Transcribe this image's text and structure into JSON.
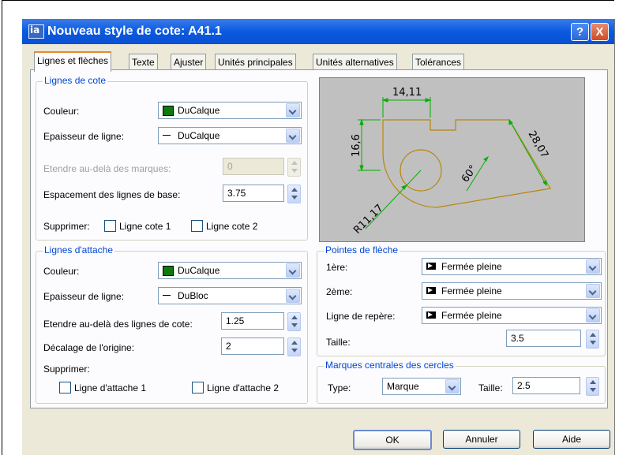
{
  "dialog": {
    "title": "Nouveau style de cote: A41.1",
    "title_icon": "ia",
    "help_label": "?",
    "close_label": "X"
  },
  "tabs": [
    {
      "label": "Lignes et flèches",
      "active": true
    },
    {
      "label": "Texte"
    },
    {
      "label": "Ajuster"
    },
    {
      "label": "Unités principales"
    },
    {
      "label": "Unités alternatives"
    },
    {
      "label": "Tolérances"
    }
  ],
  "lignes_cote": {
    "title": "Lignes de cote",
    "couleur_label": "Couleur:",
    "couleur_value": "DuCalque",
    "epaisseur_label": "Epaisseur de ligne:",
    "epaisseur_value": "DuCalque",
    "etendre_label": "Etendre au-delà des marques:",
    "etendre_value": "0",
    "espacement_label": "Espacement des lignes de base:",
    "espacement_value": "3.75",
    "supprimer_label": "Supprimer:",
    "cote1_label": "Ligne cote 1",
    "cote2_label": "Ligne cote 2"
  },
  "lignes_attache": {
    "title": "Lignes d'attache",
    "couleur_label": "Couleur:",
    "couleur_value": "DuCalque",
    "epaisseur_label": "Epaisseur de ligne:",
    "epaisseur_value": "DuBloc",
    "etendre_label": "Etendre au-delà des lignes de cote:",
    "etendre_value": "1.25",
    "decalage_label": "Décalage de l'origine:",
    "decalage_value": "2",
    "supprimer_label": "Supprimer:",
    "attache1_label": "Ligne d'attache 1",
    "attache2_label": "Ligne d'attache 2"
  },
  "preview": {
    "dim_top": "14,11",
    "dim_left": "16,6",
    "dim_right": "28,07",
    "dim_angle": "60°",
    "dim_radius": "R11,17",
    "colors": {
      "background": "#c0c0c0",
      "geometry": "#b8860b",
      "dimension": "#00b000",
      "text": "#000000"
    }
  },
  "pointes_fleche": {
    "title": "Pointes de flèche",
    "premiere_label": "1ère:",
    "premiere_value": "Fermée pleine",
    "deuxieme_label": "2ème:",
    "deuxieme_value": "Fermée pleine",
    "repere_label": "Ligne de repère:",
    "repere_value": "Fermée pleine",
    "taille_label": "Taille:",
    "taille_value": "3.5"
  },
  "marques_centrales": {
    "title": "Marques centrales des cercles",
    "type_label": "Type:",
    "type_value": "Marque",
    "taille_label": "Taille:",
    "taille_value": "2.5"
  },
  "buttons": {
    "ok": "OK",
    "annuler": "Annuler",
    "aide": "Aide"
  },
  "colors": {
    "titlebar": "#0a5ae0",
    "group_title": "#0046d5",
    "dialog_bg": "#ece9d8",
    "active_tab_accent": "#e68b2c"
  }
}
